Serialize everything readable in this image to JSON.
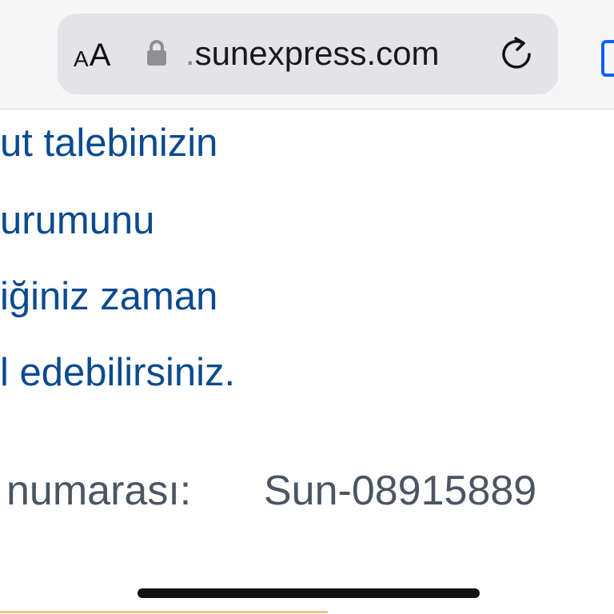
{
  "browser": {
    "text_size_small": "A",
    "text_size_large": "A",
    "url_prefix": ".",
    "url_domain": "sunexpress.com",
    "accent_color": "#0a60ff"
  },
  "content": {
    "text_color": "#0b4a8f",
    "message_lines": [
      "ut talebinizin",
      "urumunu",
      "iğiniz zaman",
      "l edebilirsiniz."
    ],
    "reference": {
      "label": "numarası:",
      "value": "Sun-08915889"
    }
  }
}
